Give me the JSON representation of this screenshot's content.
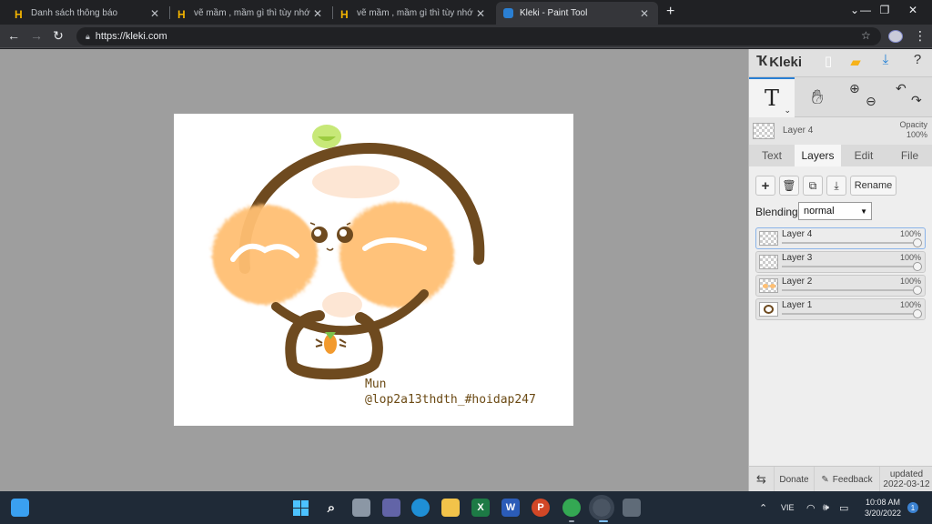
{
  "browser": {
    "tabs": [
      {
        "title": "Danh sách thông báo",
        "favicon": "hoidap-h-icon"
      },
      {
        "title": "vẽ mầm , mầm gì thì tùy nhớ ko",
        "favicon": "hoidap-h-icon"
      },
      {
        "title": "vẽ mầm , mầm gì thì tùy nhớ ko",
        "favicon": "hoidap-h-icon"
      },
      {
        "title": "Kleki - Paint Tool",
        "favicon": "kleki-icon",
        "active": true
      }
    ],
    "url": "https://kleki.com"
  },
  "canvas": {
    "text_line1": "Mun",
    "text_line2": "@lop2a13thdth_#hoidap247"
  },
  "panel": {
    "logo": "Kleki",
    "layer_label": "Layer 4",
    "opacity_label": "Opacity",
    "opacity_value": "100%",
    "tabs": [
      "Text",
      "Layers",
      "Edit",
      "File"
    ],
    "active_tab": "Layers",
    "rename_label": "Rename",
    "blending_label": "Blending",
    "blending_value": "normal",
    "layers": [
      {
        "name": "Layer 4",
        "opacity": "100%",
        "selected": true
      },
      {
        "name": "Layer 3",
        "opacity": "100%"
      },
      {
        "name": "Layer 2",
        "opacity": "100%"
      },
      {
        "name": "Layer 1",
        "opacity": "100%"
      }
    ],
    "footer": {
      "donate": "Donate",
      "feedback": "Feedback",
      "updated_label": "updated",
      "updated_date": "2022-03-12"
    }
  },
  "taskbar": {
    "language": "VIE",
    "time": "10:08 AM",
    "date": "3/20/2022",
    "notifications": "1"
  },
  "colors": {
    "accent": "#2a7fd3",
    "canvas_brown": "#6e4a1f",
    "canvas_orange": "#ffbf73"
  }
}
